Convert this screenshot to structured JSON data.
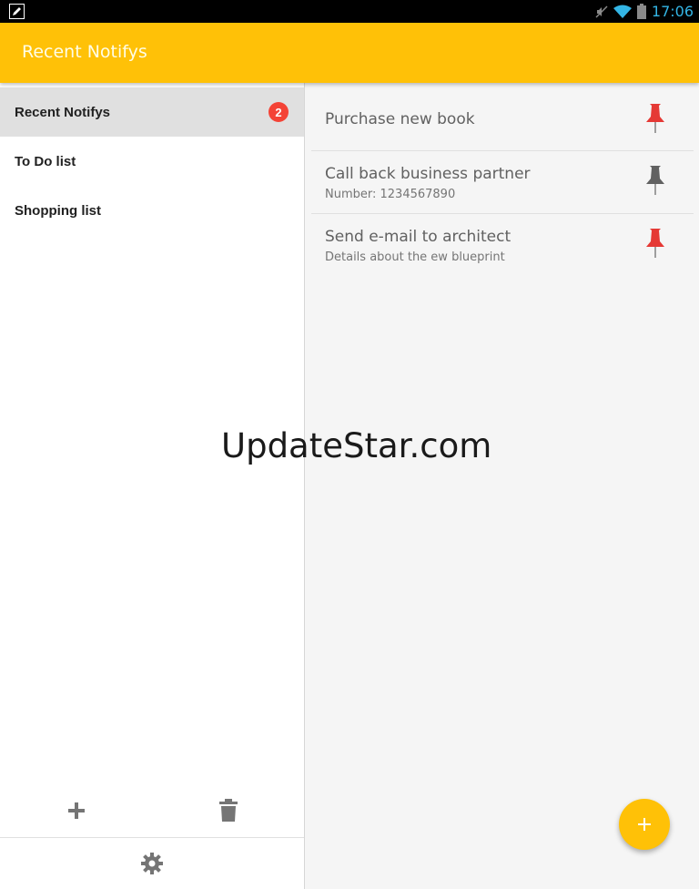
{
  "status_bar": {
    "time": "17:06",
    "icons": [
      "edit-notification-icon",
      "mute-icon",
      "wifi-icon",
      "battery-icon"
    ]
  },
  "app_bar": {
    "title": "Recent Notifys"
  },
  "colors": {
    "accent": "#ffc107",
    "badge": "#f44336",
    "pin_active": "#e53935",
    "pin_inactive": "#616161",
    "status_time": "#33b5e5"
  },
  "sidebar": {
    "items": [
      {
        "label": "Recent Notifys",
        "badge": "2",
        "selected": true
      },
      {
        "label": "To Do list"
      },
      {
        "label": "Shopping list"
      }
    ],
    "actions": [
      "plus-icon",
      "trash-icon",
      "gear-icon"
    ]
  },
  "notes": [
    {
      "title": "Purchase new book",
      "subtitle": "",
      "pinned": true,
      "pin_icon": "pin-icon"
    },
    {
      "title": "Call back business partner",
      "subtitle": "Number: 1234567890",
      "pinned": false,
      "pin_icon": "pin-icon"
    },
    {
      "title": "Send e-mail to architect",
      "subtitle": "Details about the ew blueprint",
      "pinned": true,
      "pin_icon": "pin-icon"
    }
  ],
  "watermark": "UpdateStar.com",
  "fab": {
    "icon": "plus-icon"
  }
}
